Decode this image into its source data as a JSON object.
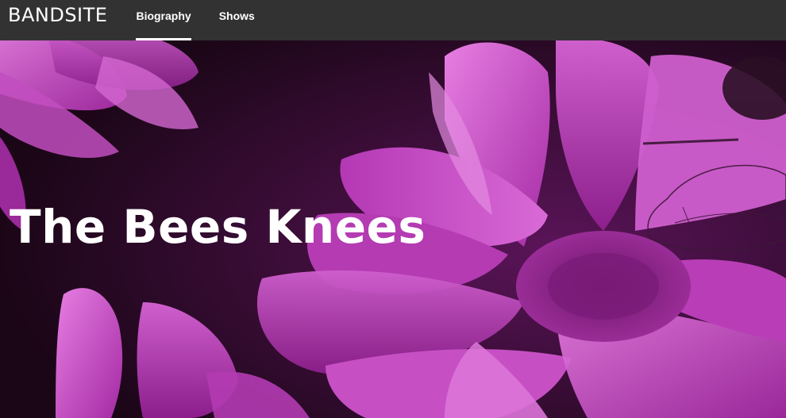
{
  "header": {
    "logo": "BANDSITE",
    "nav": [
      {
        "label": "Biography",
        "active": true
      },
      {
        "label": "Shows",
        "active": false
      }
    ]
  },
  "hero": {
    "title": "The Bees Knees",
    "image": "pink-flower-with-bee-photo"
  },
  "colors": {
    "navbar": "#323232",
    "text": "#ffffff",
    "hero_tint": "#b02fb0"
  }
}
